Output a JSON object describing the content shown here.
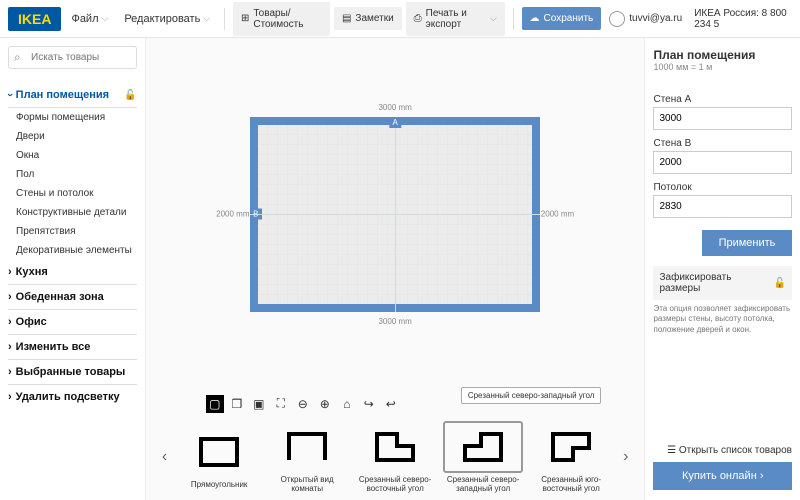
{
  "header": {
    "logo": "IKEA",
    "menu": {
      "file": "Файл",
      "edit": "Редактировать"
    },
    "toolbar": {
      "products": "Товары/Стоимость",
      "notes": "Заметки",
      "print": "Печать и экспорт",
      "save": "Сохранить"
    },
    "user": "tuvvi@ya.ru",
    "region": "ИКЕА Россия: 8 800 234 5"
  },
  "sidebar": {
    "search_placeholder": "Искать товары",
    "room_plan": {
      "title": "План помещения",
      "items": [
        "Формы помещения",
        "Двери",
        "Окна",
        "Пол",
        "Стены и потолок",
        "Конструктивные детали",
        "Препятствия",
        "Декоративные элементы"
      ]
    },
    "sections": [
      "Кухня",
      "Обеденная зона",
      "Офис",
      "Изменить все",
      "Выбранные товары",
      "Удалить подсветку"
    ]
  },
  "canvas": {
    "dim_top": "3000 mm",
    "dim_bottom": "3000 mm",
    "dim_left": "2000 mm",
    "dim_right": "2000 mm",
    "wall_a": "A",
    "wall_b": "B",
    "tooltip": "Срезанный северо-западный угол"
  },
  "shapes": {
    "labels": [
      "Прямоугольник",
      "Открытый вид комнаты",
      "Срезанный северо-восточный угол",
      "Срезанный северо-западный угол",
      "Срезанный юго-восточный угол"
    ]
  },
  "panel": {
    "title": "План помещения",
    "subtitle": "1000 мм = 1 м",
    "wall_a_label": "Стена A",
    "wall_a_value": "3000",
    "wall_b_label": "Стена B",
    "wall_b_value": "2000",
    "ceiling_label": "Потолок",
    "ceiling_value": "2830",
    "apply": "Применить",
    "lock_title": "Зафиксировать размеры",
    "lock_desc": "Эта опция позволяет зафиксировать размеры стены, высоту потолка, положение дверей и окон.",
    "open_list": "Открыть список товаров",
    "buy": "Купить онлайн  ›"
  }
}
